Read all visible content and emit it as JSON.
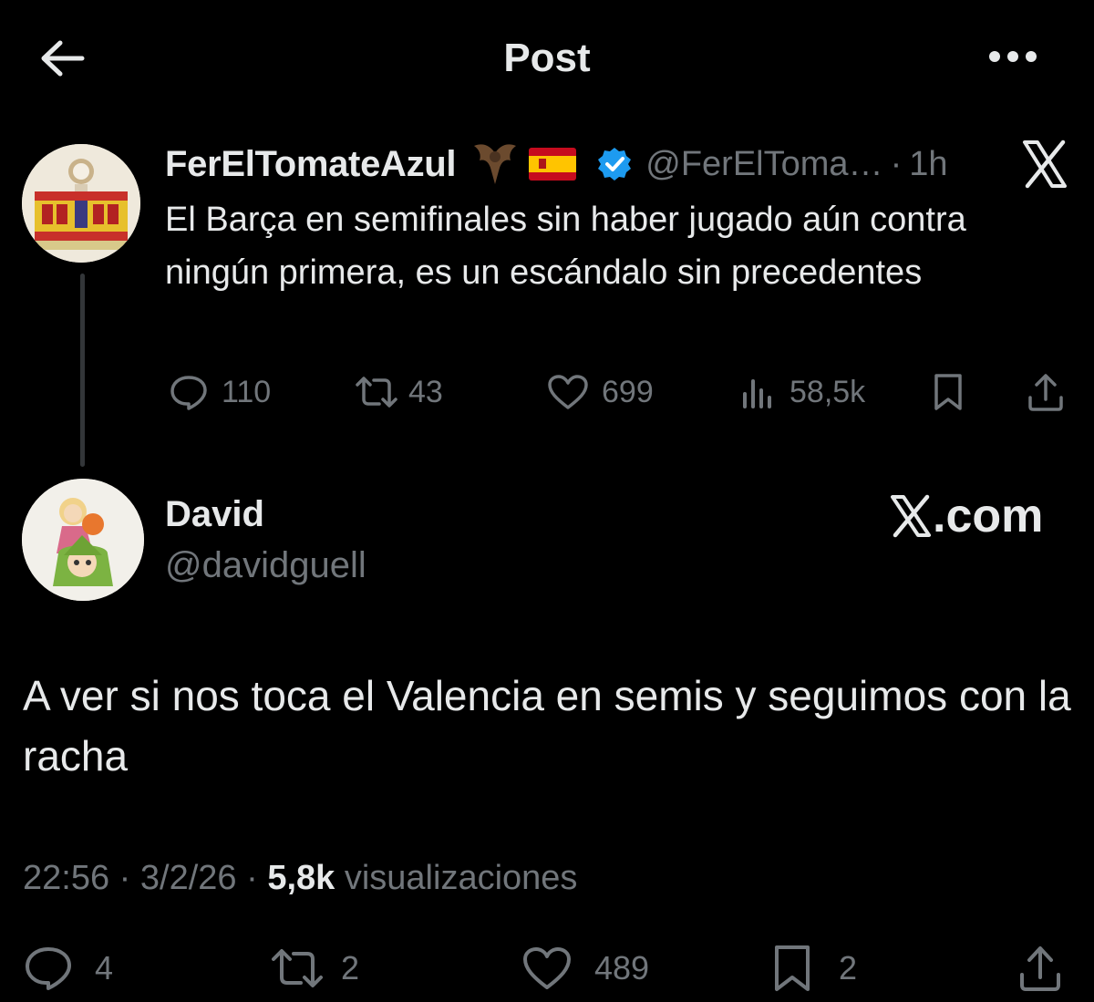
{
  "header": {
    "title": "Post"
  },
  "parent_tweet": {
    "display_name": "FerElTomateAzul",
    "handle": "@FerElToma…",
    "separator": "·",
    "time": "1h",
    "text": "El Barça en semifinales sin haber jugado aún contra ningún primera, es un escándalo sin precedentes",
    "stats": {
      "replies": "110",
      "reposts": "43",
      "likes": "699",
      "views": "58,5k"
    }
  },
  "reply_tweet": {
    "display_name": "David",
    "handle": "@davidguell",
    "text": "A ver si nos toca el Valencia en semis y seguimos con la racha",
    "time": "22:56",
    "date": "3/2/26",
    "separator": "·",
    "views_count": "5,8k",
    "views_label": "visualizaciones",
    "stats": {
      "replies": "4",
      "reposts": "2",
      "likes": "489",
      "bookmarks": "2"
    }
  },
  "watermark": {
    "text": ".com"
  },
  "colors": {
    "background": "#000000",
    "primary_text": "#e7e9ea",
    "secondary_text": "#71767b",
    "verified_blue": "#1d9bf0"
  },
  "icons": [
    "back-arrow-icon",
    "more-icon",
    "x-logo-icon",
    "verified-badge-icon",
    "reply-icon",
    "repost-icon",
    "like-icon",
    "views-icon",
    "bookmark-icon",
    "share-icon"
  ]
}
